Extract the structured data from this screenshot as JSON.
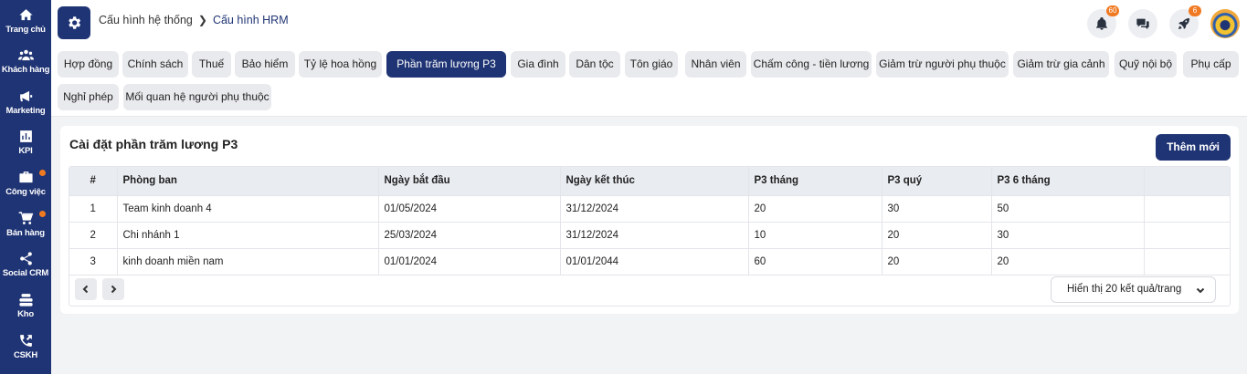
{
  "sidebar": {
    "items": [
      {
        "id": "home",
        "label": "Trang chủ",
        "icon": "home-icon"
      },
      {
        "id": "customers",
        "label": "Khách hàng",
        "icon": "users-icon"
      },
      {
        "id": "marketing",
        "label": "Marketing",
        "icon": "megaphone-icon"
      },
      {
        "id": "kpi",
        "label": "KPI",
        "icon": "bar-chart-icon"
      },
      {
        "id": "work",
        "label": "Công việc",
        "icon": "briefcase-icon"
      },
      {
        "id": "sales",
        "label": "Bán hàng",
        "icon": "cart-icon"
      },
      {
        "id": "social-crm",
        "label": "Social CRM",
        "icon": "share-icon"
      },
      {
        "id": "warehouse",
        "label": "Kho",
        "icon": "warehouse-icon"
      },
      {
        "id": "cskh",
        "label": "CSKH",
        "icon": "phone-icon"
      }
    ]
  },
  "header": {
    "breadcrumb_parent": "Cấu hình hệ thống",
    "breadcrumb_current": "Cấu hình HRM",
    "notifications_count": "60",
    "rocket_count": "6"
  },
  "tabs": [
    "Hợp đồng",
    "Chính sách",
    "Thuế",
    "Bảo hiểm",
    "Tỷ lệ hoa hồng",
    "Phần trăm lương P3",
    "Gia đình",
    "Dân tộc",
    "Tôn giáo",
    "Nhân viên",
    "Chấm công - tiền lương",
    "Giảm trừ người phụ thuộc",
    "Giảm trừ gia cảnh",
    "Quỹ nội bộ",
    "Phụ cấp",
    "Nghỉ phép",
    "Mối quan hệ người phụ thuộc"
  ],
  "active_tab": "Phần trăm lương P3",
  "card": {
    "title": "Cài đặt phần trăm lương P3",
    "add_button": "Thêm mới",
    "columns": [
      "#",
      "Phòng ban",
      "Ngày bắt đầu",
      "Ngày kết thúc",
      "P3 tháng",
      "P3 quý",
      "P3 6 tháng",
      ""
    ],
    "rows": [
      [
        "1",
        "Team kinh doanh 4",
        "01/05/2024",
        "31/12/2024",
        "20",
        "30",
        "50",
        ""
      ],
      [
        "2",
        "Chi nhánh 1",
        "25/03/2024",
        "31/12/2024",
        "10",
        "20",
        "30",
        ""
      ],
      [
        "3",
        "kinh doanh miền nam",
        "01/01/2024",
        "01/01/2044",
        "60",
        "20",
        "20",
        ""
      ]
    ],
    "page_size_label": "Hiển thị 20 kết quả/trang"
  },
  "colors": {
    "brand": "#1f3474",
    "badge": "#f07a22"
  }
}
